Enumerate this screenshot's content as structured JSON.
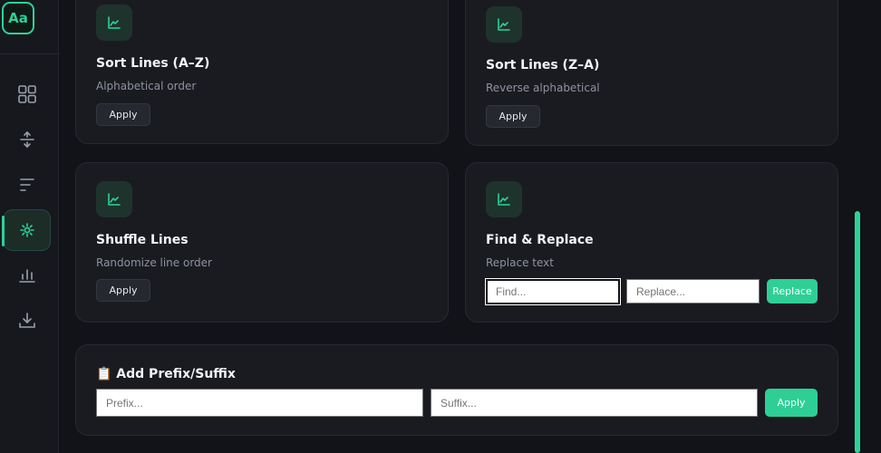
{
  "logo": {
    "text": "Aa"
  },
  "sidebar": {
    "items": [
      {
        "name": "dashboard-icon",
        "active": false
      },
      {
        "name": "expand-icon",
        "active": false
      },
      {
        "name": "sort-lines-icon",
        "active": false
      },
      {
        "name": "sparkle-icon",
        "active": true
      },
      {
        "name": "stats-icon",
        "active": false
      },
      {
        "name": "download-icon",
        "active": false
      }
    ]
  },
  "cards": [
    {
      "title": "Sort Lines (A–Z)",
      "desc": "Alphabetical order",
      "button": "Apply"
    },
    {
      "title": "Sort Lines (Z–A)",
      "desc": "Reverse alphabetical",
      "button": "Apply"
    },
    {
      "title": "Shuffle Lines",
      "desc": "Randomize line order",
      "button": "Apply"
    },
    {
      "title": "Find & Replace",
      "desc": "Replace text",
      "find_placeholder": "Find...",
      "replace_placeholder": "Replace...",
      "find_value": "",
      "replace_value": "",
      "button": "Replace"
    }
  ],
  "prefix_suffix": {
    "title": "📋 Add Prefix/Suffix",
    "prefix_placeholder": "Prefix...",
    "suffix_placeholder": "Suffix...",
    "prefix_value": "",
    "suffix_value": "",
    "button": "Apply"
  },
  "colors": {
    "accent": "#2ed199",
    "background": "#121318",
    "card": "#1a1b21"
  }
}
